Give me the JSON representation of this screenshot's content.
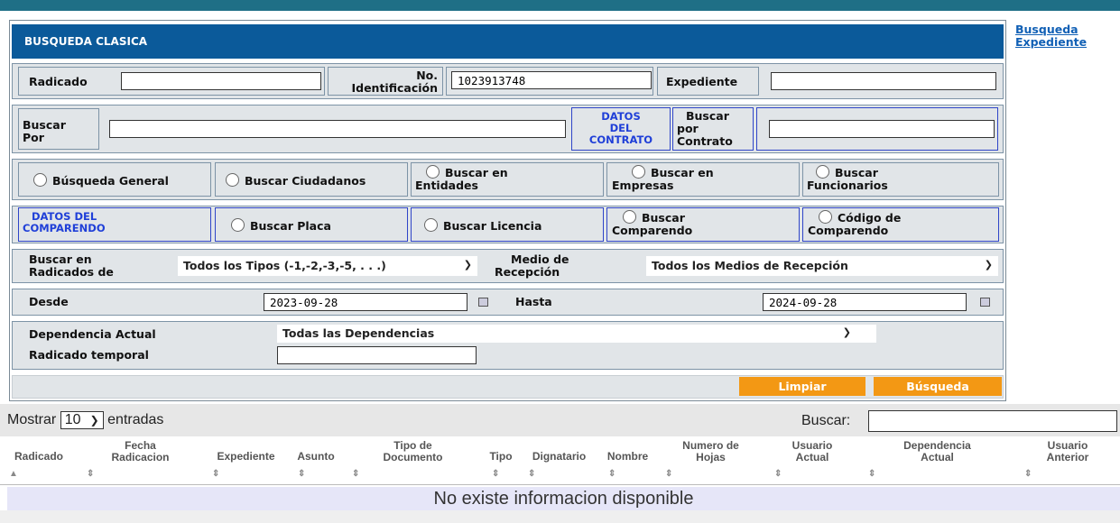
{
  "side_link": {
    "line1": "Busqueda",
    "line2": "Expediente"
  },
  "form": {
    "title": "BUSQUEDA CLASICA",
    "radicado_label": "Radicado",
    "radicado_value": "",
    "no_ident_label_1": "No.",
    "no_ident_label_2": "Identificación",
    "no_ident_value": "1023913748",
    "expediente_label": "Expediente",
    "expediente_value": "",
    "buscar_por_label_1": "Buscar",
    "buscar_por_label_2": "Por",
    "buscar_por_value": "",
    "datos_contrato": [
      "DATOS",
      "DEL",
      "CONTRATO"
    ],
    "buscar_contrato_label": [
      "Buscar",
      "por",
      "Contrato"
    ],
    "buscar_contrato_value": "",
    "radios_row1": [
      {
        "l1": "Búsqueda General",
        "l2": ""
      },
      {
        "l1": "Buscar Ciudadanos",
        "l2": ""
      },
      {
        "l1": "Buscar en",
        "l2": "Entidades"
      },
      {
        "l1": "Buscar en",
        "l2": "Empresas"
      },
      {
        "l1": "Buscar",
        "l2": "Funcionarios"
      }
    ],
    "datos_comparendo": [
      "DATOS DEL",
      "COMPARENDO"
    ],
    "radios_row2": [
      {
        "l1": "Buscar Placa",
        "l2": ""
      },
      {
        "l1": "Buscar Licencia",
        "l2": ""
      },
      {
        "l1": "Buscar",
        "l2": "Comparendo"
      },
      {
        "l1": "Código de",
        "l2": "Comparendo"
      }
    ],
    "buscar_en_label": [
      "Buscar en",
      "Radicados de"
    ],
    "tipos_select": "Todos los Tipos (-1,-2,-3,-5, . . .)",
    "medio_label": [
      "Medio de",
      "Recepción"
    ],
    "medios_select": "Todos los Medios de Recepción",
    "desde_label": "Desde",
    "desde_value": "2023-09-28",
    "hasta_label": "Hasta",
    "hasta_value": "2024-09-28",
    "dependencia_label": "Dependencia Actual",
    "dependencia_select": "Todas las Dependencias",
    "radicado_temporal_label": "Radicado temporal",
    "radicado_temporal_value": "",
    "limpiar_label": "Limpiar",
    "busqueda_label": "Búsqueda"
  },
  "table": {
    "show_label": "Mostrar",
    "page_size": "10",
    "entries_label": "entradas",
    "search_label": "Buscar:",
    "search_value": "",
    "columns": [
      [
        "Radicado",
        ""
      ],
      [
        "Fecha",
        "Radicacion"
      ],
      [
        "Expediente",
        ""
      ],
      [
        "Asunto",
        ""
      ],
      [
        "Tipo de",
        "Documento"
      ],
      [
        "Tipo",
        ""
      ],
      [
        "Dignatario",
        ""
      ],
      [
        "Nombre",
        ""
      ],
      [
        "Numero de",
        "Hojas"
      ],
      [
        "Usuario",
        "Actual"
      ],
      [
        "Dependencia",
        "Actual"
      ],
      [
        "Usuario",
        "Anterior"
      ]
    ],
    "empty_message": "No existe informacion disponible"
  },
  "colors": {
    "header": "#0b5a9a",
    "accent_button": "#f39814",
    "link": "#1160b5",
    "top_bar": "#1f6f86"
  },
  "icons": {
    "radio": "radio-button-icon",
    "calendar": "calendar-icon",
    "dropdown": "chevron-down-icon",
    "sort": "sort-icon"
  }
}
